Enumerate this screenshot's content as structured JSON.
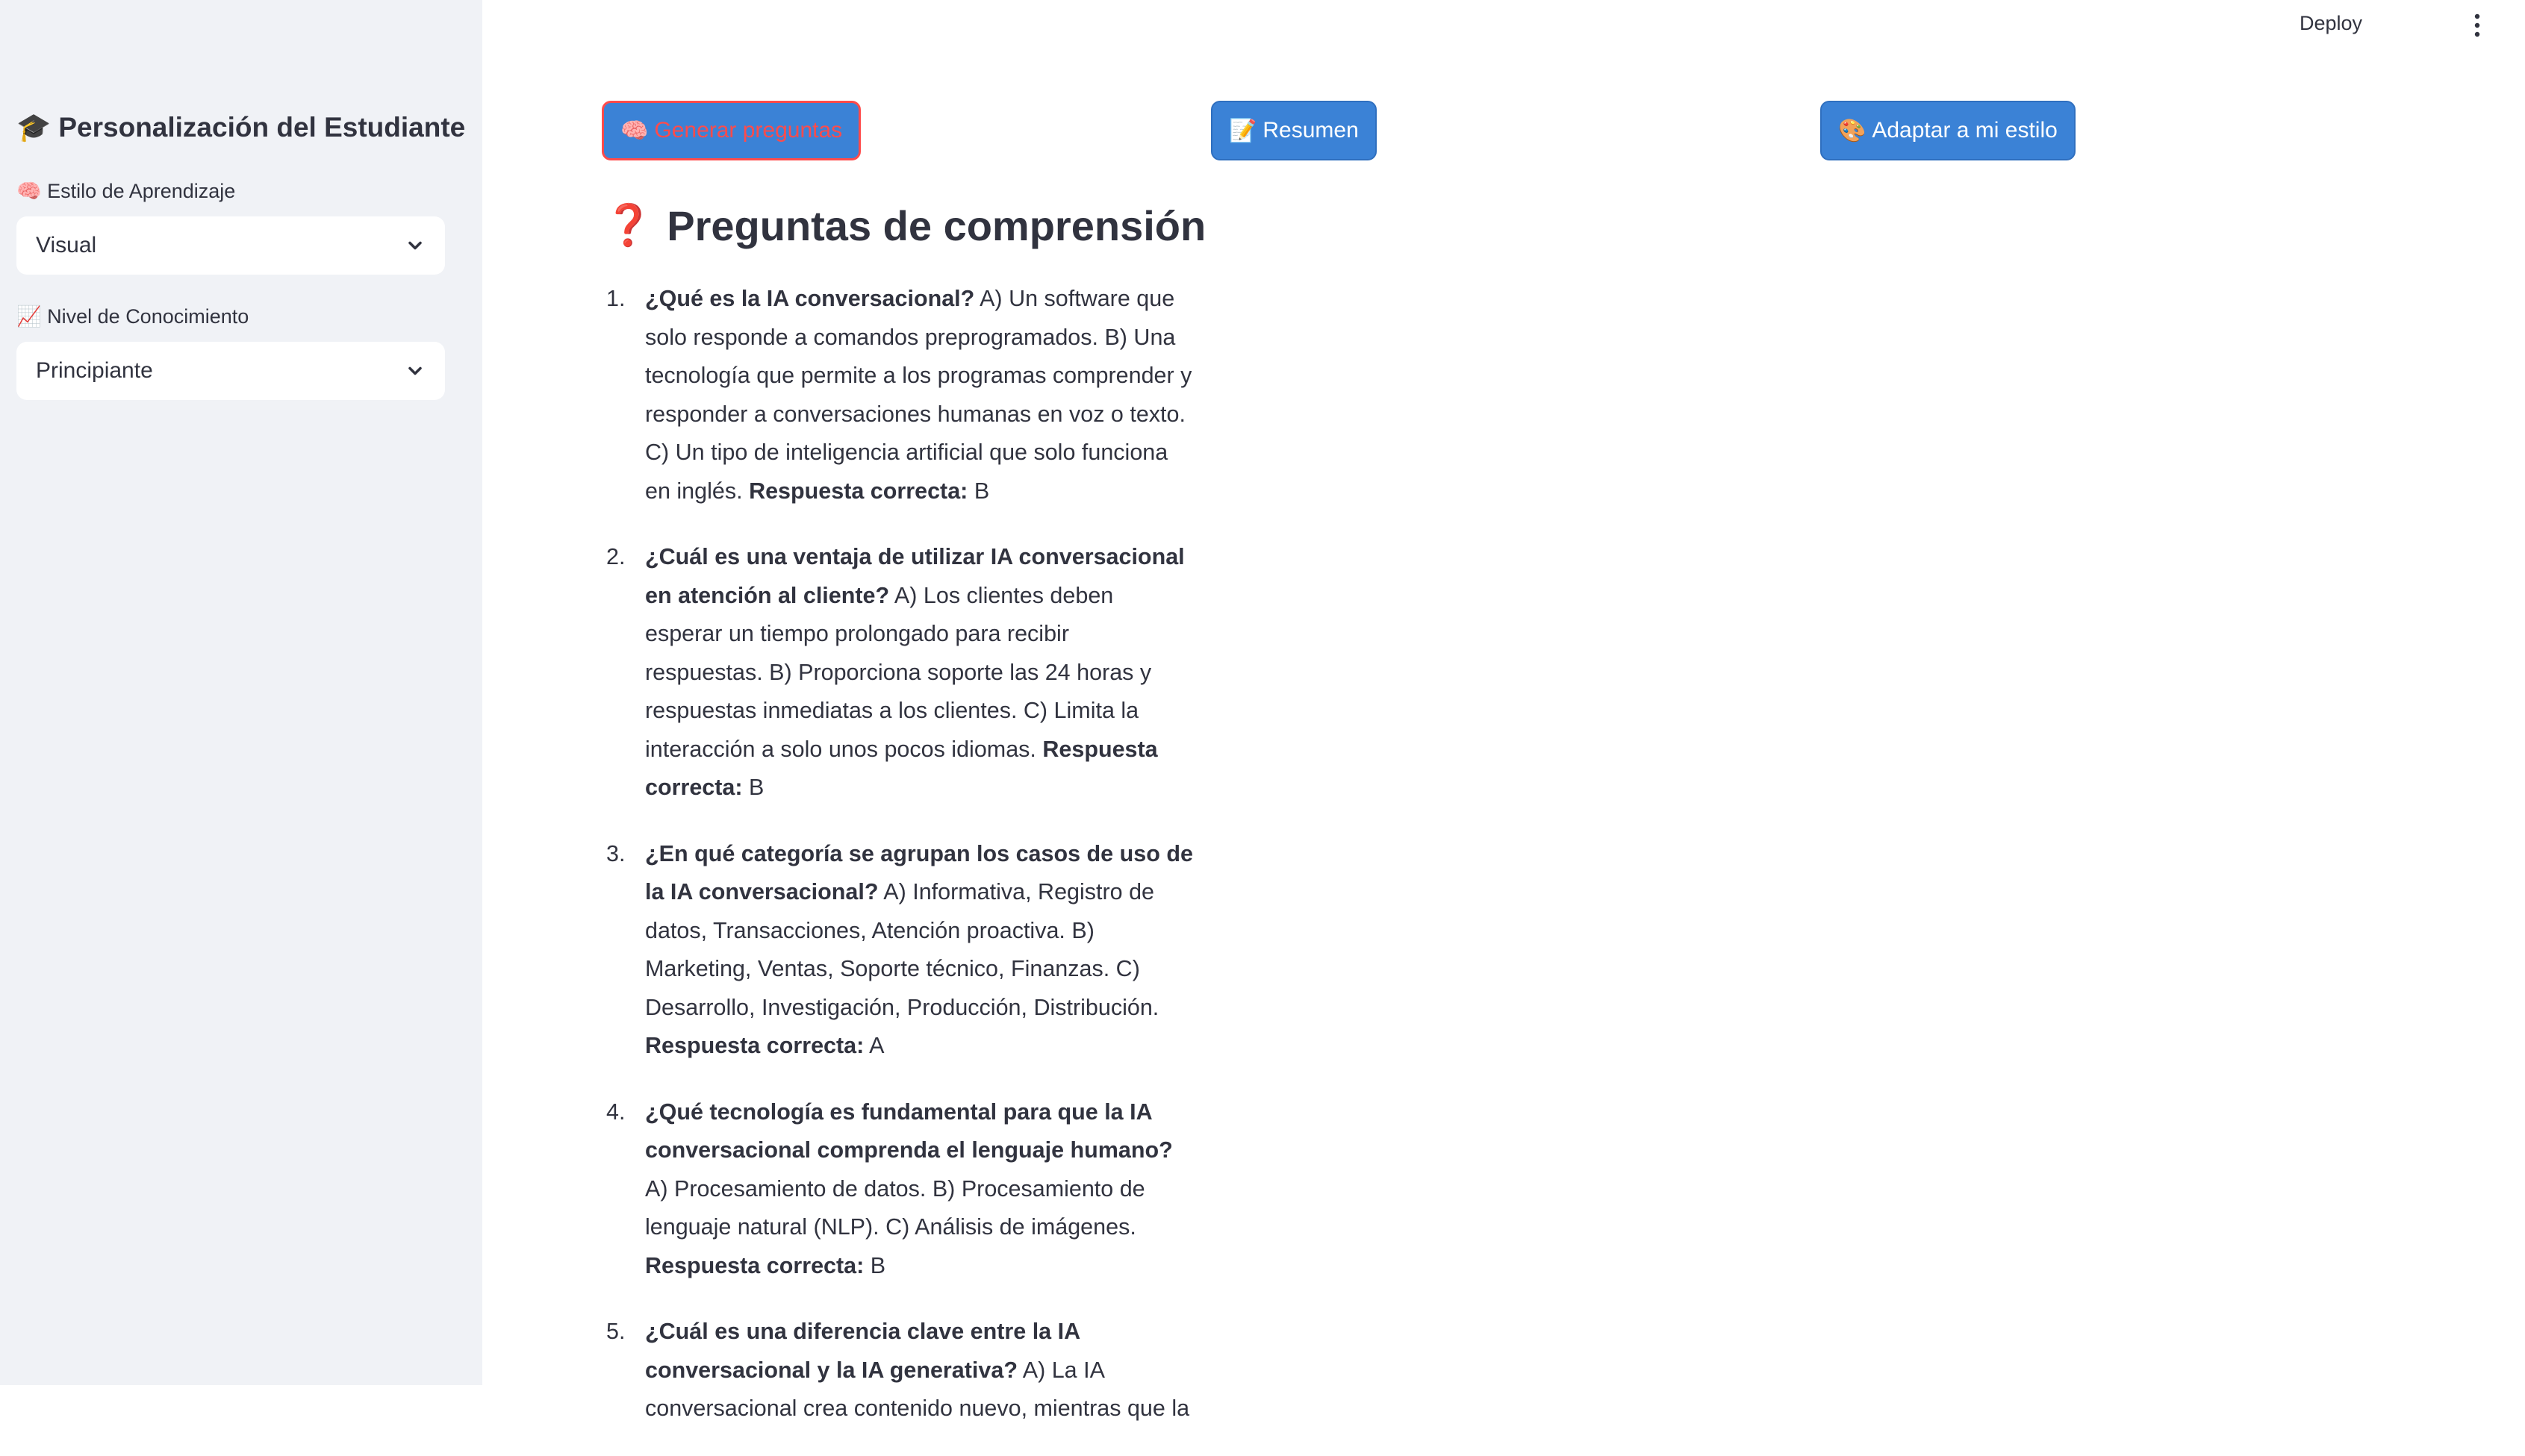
{
  "topbar": {
    "deploy_label": "Deploy",
    "menu_icon": "kebab-menu-icon"
  },
  "sidebar": {
    "title_icon": "🎓",
    "title": "Personalización del Estudiante",
    "learning_style": {
      "icon": "🧠",
      "label": "Estilo de Aprendizaje",
      "value": "Visual"
    },
    "knowledge_level": {
      "icon": "📈",
      "label": "Nivel de Conocimiento",
      "value": "Principiante"
    }
  },
  "toolbar": {
    "generate": {
      "icon": "🧠",
      "label": "Generar preguntas"
    },
    "summary": {
      "icon": "📝",
      "label": "Resumen"
    },
    "adapt": {
      "icon": "🎨",
      "label": "Adaptar a mi estilo"
    }
  },
  "section": {
    "icon": "❓",
    "title": "Preguntas de comprensión"
  },
  "questions": [
    {
      "number": "1.",
      "question": "¿Qué es la IA conversacional?",
      "options": "A) Un software que solo responde a comandos preprogramados. B) Una tecnología que permite a los programas comprender y responder a conversaciones humanas en voz o texto. C) Un tipo de inteligencia artificial que solo funciona en inglés.",
      "answer_label": "Respuesta correcta:",
      "answer": "B"
    },
    {
      "number": "2.",
      "question": "¿Cuál es una ventaja de utilizar IA conversacional en atención al cliente?",
      "options": "A) Los clientes deben esperar un tiempo prolongado para recibir respuestas. B) Proporciona soporte las 24 horas y respuestas inmediatas a los clientes. C) Limita la interacción a solo unos pocos idiomas.",
      "answer_label": "Respuesta correcta:",
      "answer": "B"
    },
    {
      "number": "3.",
      "question": "¿En qué categoría se agrupan los casos de uso de la IA conversacional?",
      "options": "A) Informativa, Registro de datos, Transacciones, Atención proactiva. B) Marketing, Ventas, Soporte técnico, Finanzas. C) Desarrollo, Investigación, Producción, Distribución.",
      "answer_label": "Respuesta correcta:",
      "answer": "A"
    },
    {
      "number": "4.",
      "question": "¿Qué tecnología es fundamental para que la IA conversacional comprenda el lenguaje humano?",
      "options": "A) Procesamiento de datos. B) Procesamiento de lenguaje natural (NLP). C) Análisis de imágenes.",
      "answer_label": "Respuesta correcta:",
      "answer": "B"
    },
    {
      "number": "5.",
      "question": "¿Cuál es una diferencia clave entre la IA conversacional y la IA generativa?",
      "options": "A) La IA conversacional crea contenido nuevo, mientras que la",
      "answer_label": "",
      "answer": ""
    }
  ]
}
